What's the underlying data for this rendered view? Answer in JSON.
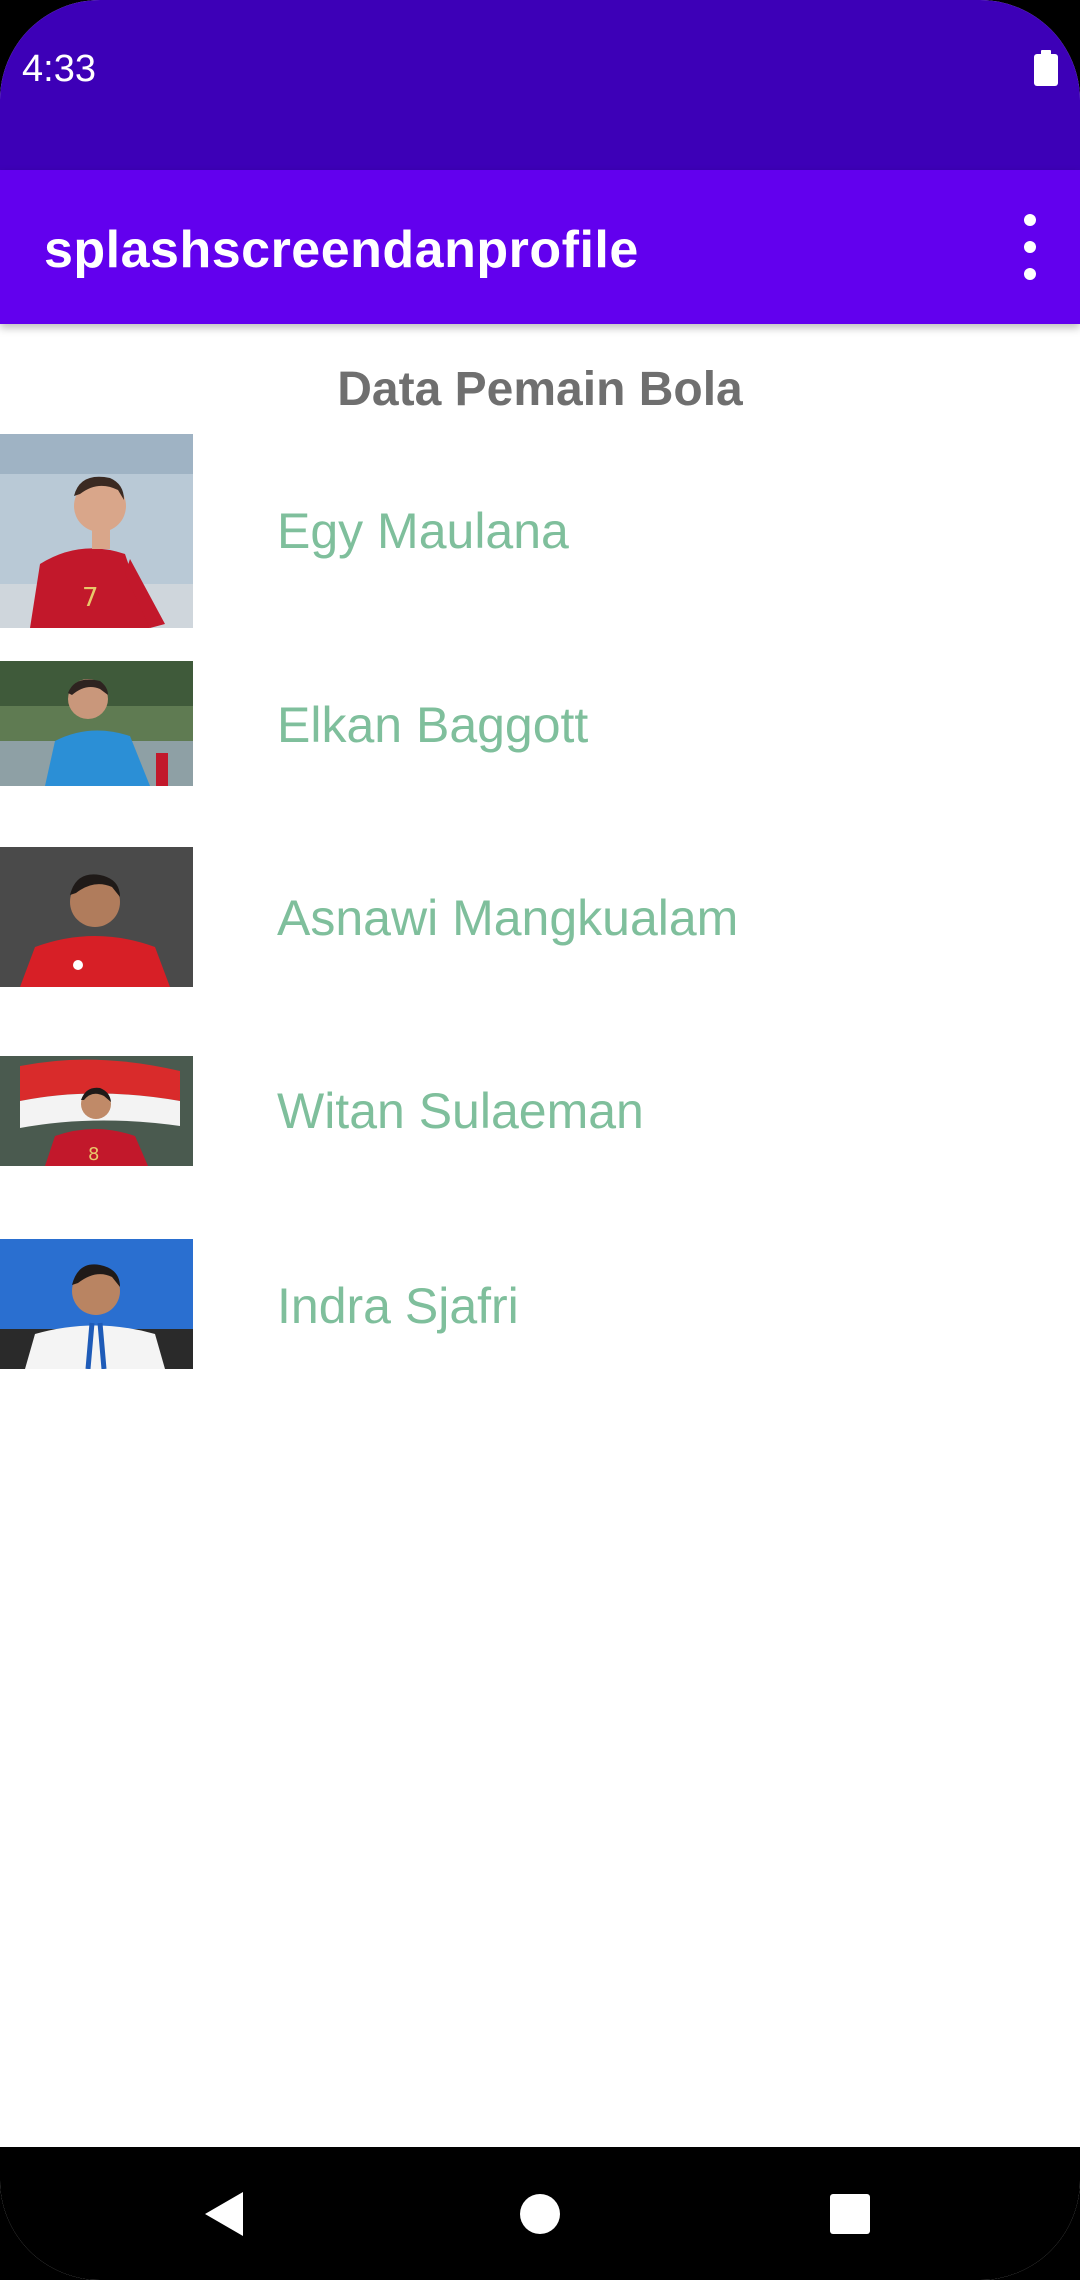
{
  "status_bar": {
    "time": "4:33",
    "battery_icon": "battery-full-icon"
  },
  "app_bar": {
    "title": "splashscreendanprofile",
    "menu_icon": "more-vert-icon"
  },
  "list": {
    "heading": "Data Pemain Bola",
    "players": [
      {
        "name": "Egy Maulana"
      },
      {
        "name": "Elkan Baggott"
      },
      {
        "name": "Asnawi Mangkualam"
      },
      {
        "name": "Witan Sulaeman"
      },
      {
        "name": "Indra Sjafri"
      }
    ]
  },
  "nav_bar": {
    "back_icon": "back-icon",
    "home_icon": "home-icon",
    "recents_icon": "recents-icon"
  },
  "colors": {
    "status_bar": "#3d00b7",
    "app_bar": "#6200ee",
    "heading_text": "#6f6f6f",
    "player_name": "#7fbf9c"
  }
}
